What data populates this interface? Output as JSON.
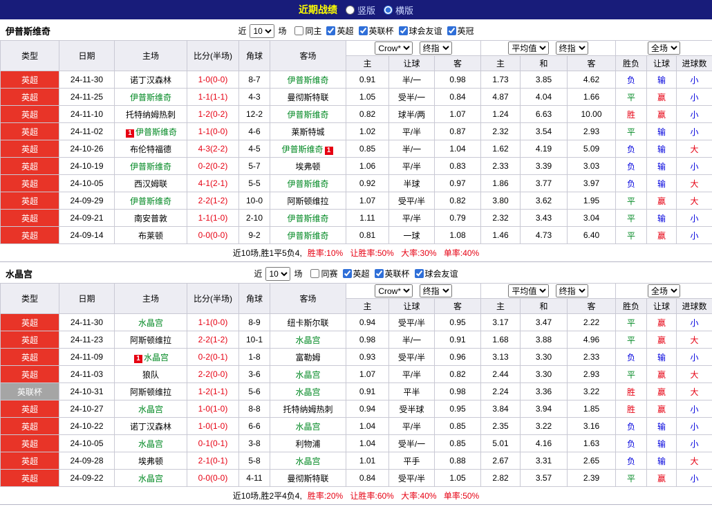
{
  "title_bar": {
    "title": "近期战绩",
    "layout_options": [
      {
        "label": "竖版",
        "selected": false
      },
      {
        "label": "横版",
        "selected": true
      }
    ]
  },
  "colors": {
    "title_bar_bg": "#181c7a",
    "title_text": "#ffff00",
    "epl_badge_bg": "#e83428",
    "cup_badge_bg": "#a5a5a5",
    "focus_team": "#008822",
    "score_text": "#e60012",
    "summary_stats": "#e60012"
  },
  "value_colors": {
    "胜": "#e60012",
    "平": "#008822",
    "负": "#0000dd",
    "赢": "#e60012",
    "输": "#0000dd",
    "大": "#e60012",
    "小": "#0000dd"
  },
  "table_header": {
    "left_columns": [
      "类型",
      "日期",
      "主场",
      "比分(半场)",
      "角球",
      "客场"
    ],
    "sub_columns": [
      "主",
      "让球",
      "客",
      "主",
      "和",
      "客",
      "胜负",
      "让球",
      "进球数"
    ],
    "asia_selects": [
      "Crow*",
      "终指"
    ],
    "europe_selects": [
      "平均值",
      "终指"
    ],
    "scope_select": "全场"
  },
  "sections": [
    {
      "team": "伊普斯维奇",
      "filter": {
        "near_label": "近",
        "count": "10",
        "games_label": "场",
        "checkboxes": [
          {
            "label": "同主",
            "checked": false
          },
          {
            "label": "英超",
            "checked": true
          },
          {
            "label": "英联杯",
            "checked": true
          },
          {
            "label": "球会友谊",
            "checked": true
          },
          {
            "label": "英冠",
            "checked": true
          }
        ]
      },
      "rows": [
        {
          "league": "英超",
          "date": "24-11-30",
          "home": "诺丁汉森林",
          "score": "1-0(0-0)",
          "corner": "8-7",
          "away": "伊普斯维奇",
          "away_focus": true,
          "h": "0.91",
          "hcap": "半/一",
          "a": "0.98",
          "eh": "1.73",
          "ed": "3.85",
          "ea": "4.62",
          "result": "负",
          "handicap_result": "输",
          "goals": "小"
        },
        {
          "league": "英超",
          "date": "24-11-25",
          "home": "伊普斯维奇",
          "home_focus": true,
          "score": "1-1(1-1)",
          "corner": "4-3",
          "away": "曼彻斯特联",
          "h": "1.05",
          "hcap": "受半/一",
          "a": "0.84",
          "eh": "4.87",
          "ed": "4.04",
          "ea": "1.66",
          "result": "平",
          "handicap_result": "赢",
          "goals": "小"
        },
        {
          "league": "英超",
          "date": "24-11-10",
          "home": "托特纳姆热刺",
          "score": "1-2(0-2)",
          "corner": "12-2",
          "away": "伊普斯维奇",
          "away_focus": true,
          "h": "0.82",
          "hcap": "球半/两",
          "a": "1.07",
          "eh": "1.24",
          "ed": "6.63",
          "ea": "10.00",
          "result": "胜",
          "handicap_result": "赢",
          "goals": "小"
        },
        {
          "league": "英超",
          "date": "24-11-02",
          "home": "伊普斯维奇",
          "home_focus": true,
          "home_card": "1",
          "score": "1-1(0-0)",
          "corner": "4-6",
          "away": "莱斯特城",
          "h": "1.02",
          "hcap": "平/半",
          "a": "0.87",
          "eh": "2.32",
          "ed": "3.54",
          "ea": "2.93",
          "result": "平",
          "handicap_result": "输",
          "goals": "小"
        },
        {
          "league": "英超",
          "date": "24-10-26",
          "home": "布伦特福德",
          "score": "4-3(2-2)",
          "corner": "4-5",
          "away": "伊普斯维奇",
          "away_focus": true,
          "away_card": "1",
          "h": "0.85",
          "hcap": "半/一",
          "a": "1.04",
          "eh": "1.62",
          "ed": "4.19",
          "ea": "5.09",
          "result": "负",
          "handicap_result": "输",
          "goals": "大"
        },
        {
          "league": "英超",
          "date": "24-10-19",
          "home": "伊普斯维奇",
          "home_focus": true,
          "score": "0-2(0-2)",
          "corner": "5-7",
          "away": "埃弗顿",
          "h": "1.06",
          "hcap": "平/半",
          "a": "0.83",
          "eh": "2.33",
          "ed": "3.39",
          "ea": "3.03",
          "result": "负",
          "handicap_result": "输",
          "goals": "小"
        },
        {
          "league": "英超",
          "date": "24-10-05",
          "home": "西汉姆联",
          "score": "4-1(2-1)",
          "corner": "5-5",
          "away": "伊普斯维奇",
          "away_focus": true,
          "h": "0.92",
          "hcap": "半球",
          "a": "0.97",
          "eh": "1.86",
          "ed": "3.77",
          "ea": "3.97",
          "result": "负",
          "handicap_result": "输",
          "goals": "大"
        },
        {
          "league": "英超",
          "date": "24-09-29",
          "home": "伊普斯维奇",
          "home_focus": true,
          "score": "2-2(1-2)",
          "corner": "10-0",
          "away": "阿斯顿维拉",
          "h": "1.07",
          "hcap": "受平/半",
          "a": "0.82",
          "eh": "3.80",
          "ed": "3.62",
          "ea": "1.95",
          "result": "平",
          "handicap_result": "赢",
          "goals": "大"
        },
        {
          "league": "英超",
          "date": "24-09-21",
          "home": "南安普敦",
          "score": "1-1(1-0)",
          "corner": "2-10",
          "away": "伊普斯维奇",
          "away_focus": true,
          "h": "1.11",
          "hcap": "平/半",
          "a": "0.79",
          "eh": "2.32",
          "ed": "3.43",
          "ea": "3.04",
          "result": "平",
          "handicap_result": "输",
          "goals": "小"
        },
        {
          "league": "英超",
          "date": "24-09-14",
          "home": "布莱顿",
          "score": "0-0(0-0)",
          "corner": "9-2",
          "away": "伊普斯维奇",
          "away_focus": true,
          "h": "0.81",
          "hcap": "一球",
          "a": "1.08",
          "eh": "1.46",
          "ed": "4.73",
          "ea": "6.40",
          "result": "平",
          "handicap_result": "赢",
          "goals": "小"
        }
      ],
      "summary_prefix": "近10场,胜1平5负4,",
      "summary_stats": "胜率:10% 让胜率:50% 大率:30% 单率:40%"
    },
    {
      "team": "水晶宫",
      "filter": {
        "near_label": "近",
        "count": "10",
        "games_label": "场",
        "checkboxes": [
          {
            "label": "同赛",
            "checked": false
          },
          {
            "label": "英超",
            "checked": true
          },
          {
            "label": "英联杯",
            "checked": true
          },
          {
            "label": "球会友谊",
            "checked": true
          }
        ]
      },
      "rows": [
        {
          "league": "英超",
          "date": "24-11-30",
          "home": "水晶宫",
          "home_focus": true,
          "score": "1-1(0-0)",
          "corner": "8-9",
          "away": "纽卡斯尔联",
          "h": "0.94",
          "hcap": "受平/半",
          "a": "0.95",
          "eh": "3.17",
          "ed": "3.47",
          "ea": "2.22",
          "result": "平",
          "handicap_result": "赢",
          "goals": "小"
        },
        {
          "league": "英超",
          "date": "24-11-23",
          "home": "阿斯顿维拉",
          "score": "2-2(1-2)",
          "corner": "10-1",
          "away": "水晶宫",
          "away_focus": true,
          "h": "0.98",
          "hcap": "半/一",
          "a": "0.91",
          "eh": "1.68",
          "ed": "3.88",
          "ea": "4.96",
          "result": "平",
          "handicap_result": "赢",
          "goals": "大"
        },
        {
          "league": "英超",
          "date": "24-11-09",
          "home": "水晶宫",
          "home_focus": true,
          "home_card": "1",
          "score": "0-2(0-1)",
          "corner": "1-8",
          "away": "富勒姆",
          "h": "0.93",
          "hcap": "受平/半",
          "a": "0.96",
          "eh": "3.13",
          "ed": "3.30",
          "ea": "2.33",
          "result": "负",
          "handicap_result": "输",
          "goals": "小"
        },
        {
          "league": "英超",
          "date": "24-11-03",
          "home": "狼队",
          "score": "2-2(0-0)",
          "corner": "3-6",
          "away": "水晶宫",
          "away_focus": true,
          "h": "1.07",
          "hcap": "平/半",
          "a": "0.82",
          "eh": "2.44",
          "ed": "3.30",
          "ea": "2.93",
          "result": "平",
          "handicap_result": "赢",
          "goals": "大"
        },
        {
          "league": "英联杯",
          "date": "24-10-31",
          "home": "阿斯顿维拉",
          "score": "1-2(1-1)",
          "corner": "5-6",
          "away": "水晶宫",
          "away_focus": true,
          "h": "0.91",
          "hcap": "平半",
          "a": "0.98",
          "eh": "2.24",
          "ed": "3.36",
          "ea": "3.22",
          "result": "胜",
          "handicap_result": "赢",
          "goals": "大"
        },
        {
          "league": "英超",
          "date": "24-10-27",
          "home": "水晶宫",
          "home_focus": true,
          "score": "1-0(1-0)",
          "corner": "8-8",
          "away": "托特纳姆热刺",
          "h": "0.94",
          "hcap": "受半球",
          "a": "0.95",
          "eh": "3.84",
          "ed": "3.94",
          "ea": "1.85",
          "result": "胜",
          "handicap_result": "赢",
          "goals": "小"
        },
        {
          "league": "英超",
          "date": "24-10-22",
          "home": "诺丁汉森林",
          "score": "1-0(1-0)",
          "corner": "6-6",
          "away": "水晶宫",
          "away_focus": true,
          "h": "1.04",
          "hcap": "平/半",
          "a": "0.85",
          "eh": "2.35",
          "ed": "3.22",
          "ea": "3.16",
          "result": "负",
          "handicap_result": "输",
          "goals": "小"
        },
        {
          "league": "英超",
          "date": "24-10-05",
          "home": "水晶宫",
          "home_focus": true,
          "score": "0-1(0-1)",
          "corner": "3-8",
          "away": "利物浦",
          "h": "1.04",
          "hcap": "受半/一",
          "a": "0.85",
          "eh": "5.01",
          "ed": "4.16",
          "ea": "1.63",
          "result": "负",
          "handicap_result": "输",
          "goals": "小"
        },
        {
          "league": "英超",
          "date": "24-09-28",
          "home": "埃弗顿",
          "score": "2-1(0-1)",
          "corner": "5-8",
          "away": "水晶宫",
          "away_focus": true,
          "h": "1.01",
          "hcap": "平手",
          "a": "0.88",
          "eh": "2.67",
          "ed": "3.31",
          "ea": "2.65",
          "result": "负",
          "handicap_result": "输",
          "goals": "大"
        },
        {
          "league": "英超",
          "date": "24-09-22",
          "home": "水晶宫",
          "home_focus": true,
          "score": "0-0(0-0)",
          "corner": "4-11",
          "away": "曼彻斯特联",
          "h": "0.84",
          "hcap": "受平/半",
          "a": "1.05",
          "eh": "2.82",
          "ed": "3.57",
          "ea": "2.39",
          "result": "平",
          "handicap_result": "赢",
          "goals": "小"
        }
      ],
      "summary_prefix": "近10场,胜2平4负4,",
      "summary_stats": "胜率:20% 让胜率:60% 大率:40% 单率:50%"
    }
  ]
}
